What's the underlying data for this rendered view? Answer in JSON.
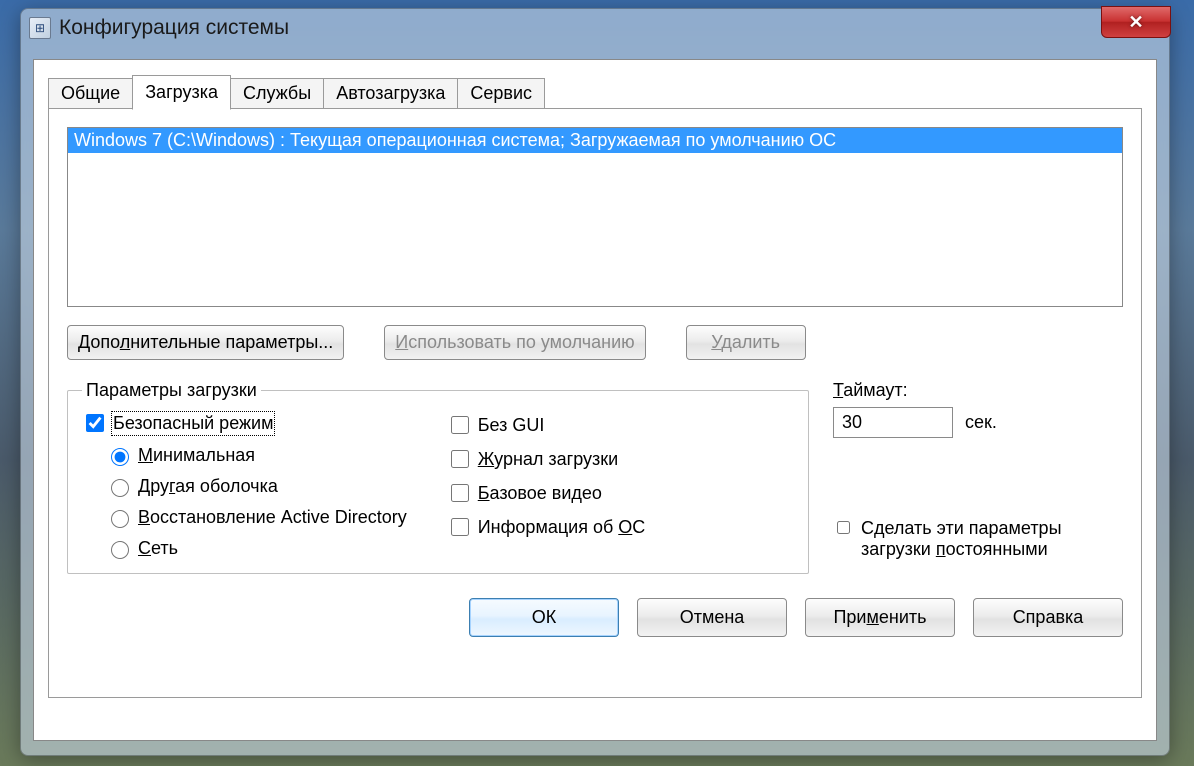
{
  "window": {
    "title": "Конфигурация системы",
    "close_glyph": "✕"
  },
  "tabs": {
    "general": "Общие",
    "boot": "Загрузка",
    "services": "Службы",
    "startup": "Автозагрузка",
    "tools": "Сервис"
  },
  "oslist": {
    "row0": "Windows 7 (C:\\Windows) : Текущая операционная система; Загружаемая по умолчанию ОС"
  },
  "buttons": {
    "advanced_pre": "Допо",
    "advanced_u": "л",
    "advanced_post": "нительные параметры...",
    "setdefault_u": "И",
    "setdefault_post": "спользовать по умолчанию",
    "delete_u": "У",
    "delete_post": "далить",
    "ok": "ОК",
    "cancel": "Отмена",
    "apply_pre": "При",
    "apply_u": "м",
    "apply_post": "енить",
    "help": "Справка"
  },
  "group": {
    "legend": "Параметры загрузки",
    "safe_mode": "Безопасный режим",
    "minimal_u": "М",
    "minimal_post": "инимальная",
    "altshell_pre": "Дру",
    "altshell_u": "г",
    "altshell_post": "ая оболочка",
    "adrepair_u": "В",
    "adrepair_post": "осстановление Active Directory",
    "network_u": "С",
    "network_post": "еть",
    "nogui": "Без GUI",
    "bootlog_u": "Ж",
    "bootlog_post": "урнал загрузки",
    "basevideo_u": "Б",
    "basevideo_post": "азовое видео",
    "osinfo_pre": "Информация  об ",
    "osinfo_u": "О",
    "osinfo_post": "С"
  },
  "timeout": {
    "label_u": "Т",
    "label_post": "аймаут:",
    "value": "30",
    "unit": "сек."
  },
  "permanent": {
    "line1": "Сделать эти параметры",
    "line2_pre": "загрузки ",
    "line2_u": "п",
    "line2_post": "остоянными"
  }
}
